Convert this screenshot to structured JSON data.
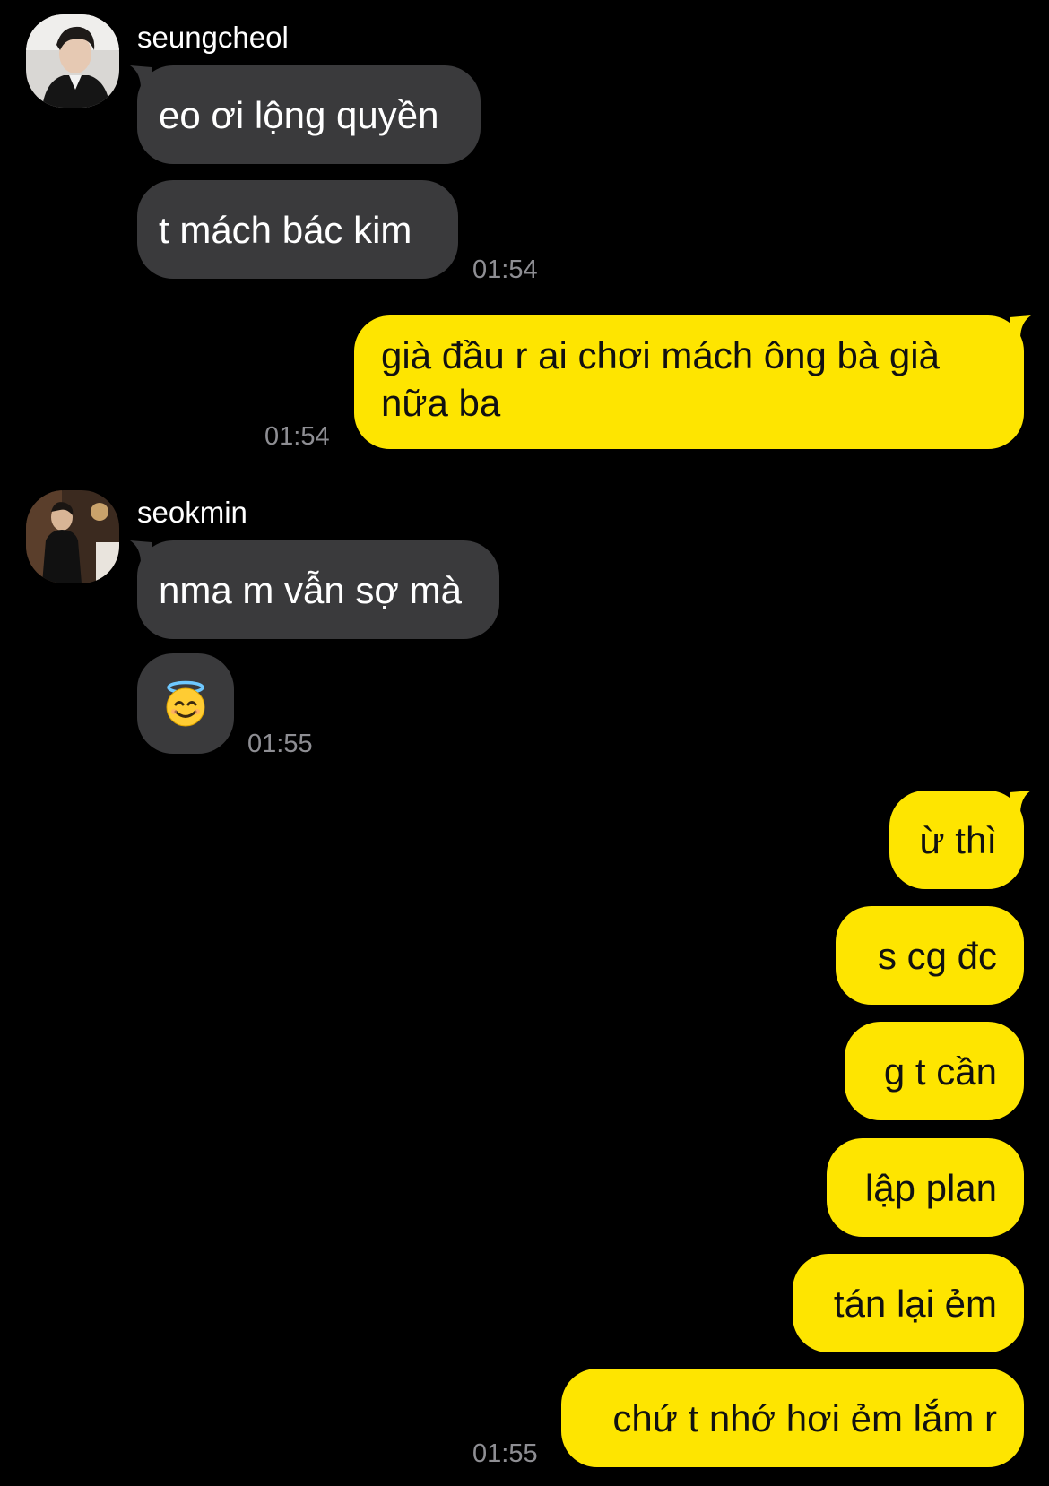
{
  "conversation": {
    "groups": [
      {
        "sender": "seungcheol",
        "messages": [
          "eo ơi lộng quyền",
          "t mách bác kim"
        ],
        "time": "01:54"
      },
      {
        "sender": "me",
        "messages": [
          "già đầu r ai chơi mách ông bà già nữa ba"
        ],
        "time": "01:54"
      },
      {
        "sender": "seokmin",
        "messages": [
          "nma m vẫn sợ mà"
        ],
        "emoji": "smiling-face-with-halo",
        "time": "01:55"
      },
      {
        "sender": "me",
        "messages": [
          "ừ thì",
          "s cg đc",
          "g t cần",
          "lập plan",
          "tán lại ẻm",
          "chứ t nhớ hơi ẻm lắm r"
        ],
        "time": "01:55"
      }
    ]
  },
  "colors": {
    "background": "#000000",
    "incoming_bubble": "#3a3a3c",
    "outgoing_bubble": "#fee500",
    "timestamp": "#8e8e93"
  }
}
